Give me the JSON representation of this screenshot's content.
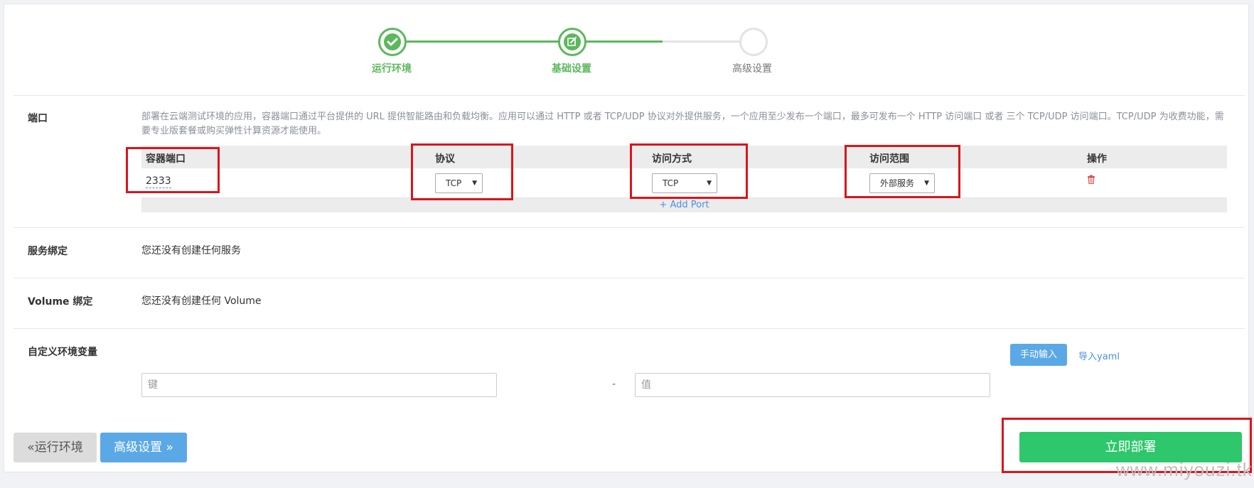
{
  "stepper": {
    "steps": [
      {
        "label": "运行环境",
        "icon": "check-icon",
        "state": "done"
      },
      {
        "label": "基础设置",
        "icon": "edit-icon",
        "state": "active"
      },
      {
        "label": "高级设置",
        "icon": "",
        "state": "todo"
      }
    ]
  },
  "ports": {
    "label": "端口",
    "description": "部署在云端测试环境的应用，容器端口通过平台提供的 URL 提供智能路由和负载均衡。应用可以通过 HTTP 或者 TCP/UDP 协议对外提供服务，一个应用至少发布一个端口，最多可发布一个 HTTP 访问端口 或者 三个 TCP/UDP 访问端口。TCP/UDP 为收费功能，需要专业版套餐或购买弹性计算资源才能使用。",
    "columns": [
      "容器端口",
      "协议",
      "访问方式",
      "访问范围",
      "操作"
    ],
    "rows": [
      {
        "port": "2333",
        "protocol": "TCP",
        "access_method": "TCP",
        "access_scope": "外部服务",
        "action_icon": "trash-icon"
      }
    ],
    "add_port": "+ Add Port"
  },
  "service_binding": {
    "label": "服务绑定",
    "value": "您还没有创建任何服务"
  },
  "volume_binding": {
    "label": "Volume 绑定",
    "value": "您还没有创建任何 Volume"
  },
  "env_vars": {
    "label": "自定义环境变量",
    "manual_input": "手动输入",
    "import_yaml": "导入yaml",
    "key_placeholder": "键",
    "value_placeholder": "值",
    "separator": "-"
  },
  "footer": {
    "prev_button": "«运行环境",
    "next_button": "高级设置 »",
    "deploy_button": "立即部署"
  },
  "watermark": "www.miyouzi.tk",
  "colors": {
    "success": "#5cb85c",
    "primary": "#5ba8e6",
    "deploy": "#2ec76b",
    "highlight": "#d9151c"
  }
}
